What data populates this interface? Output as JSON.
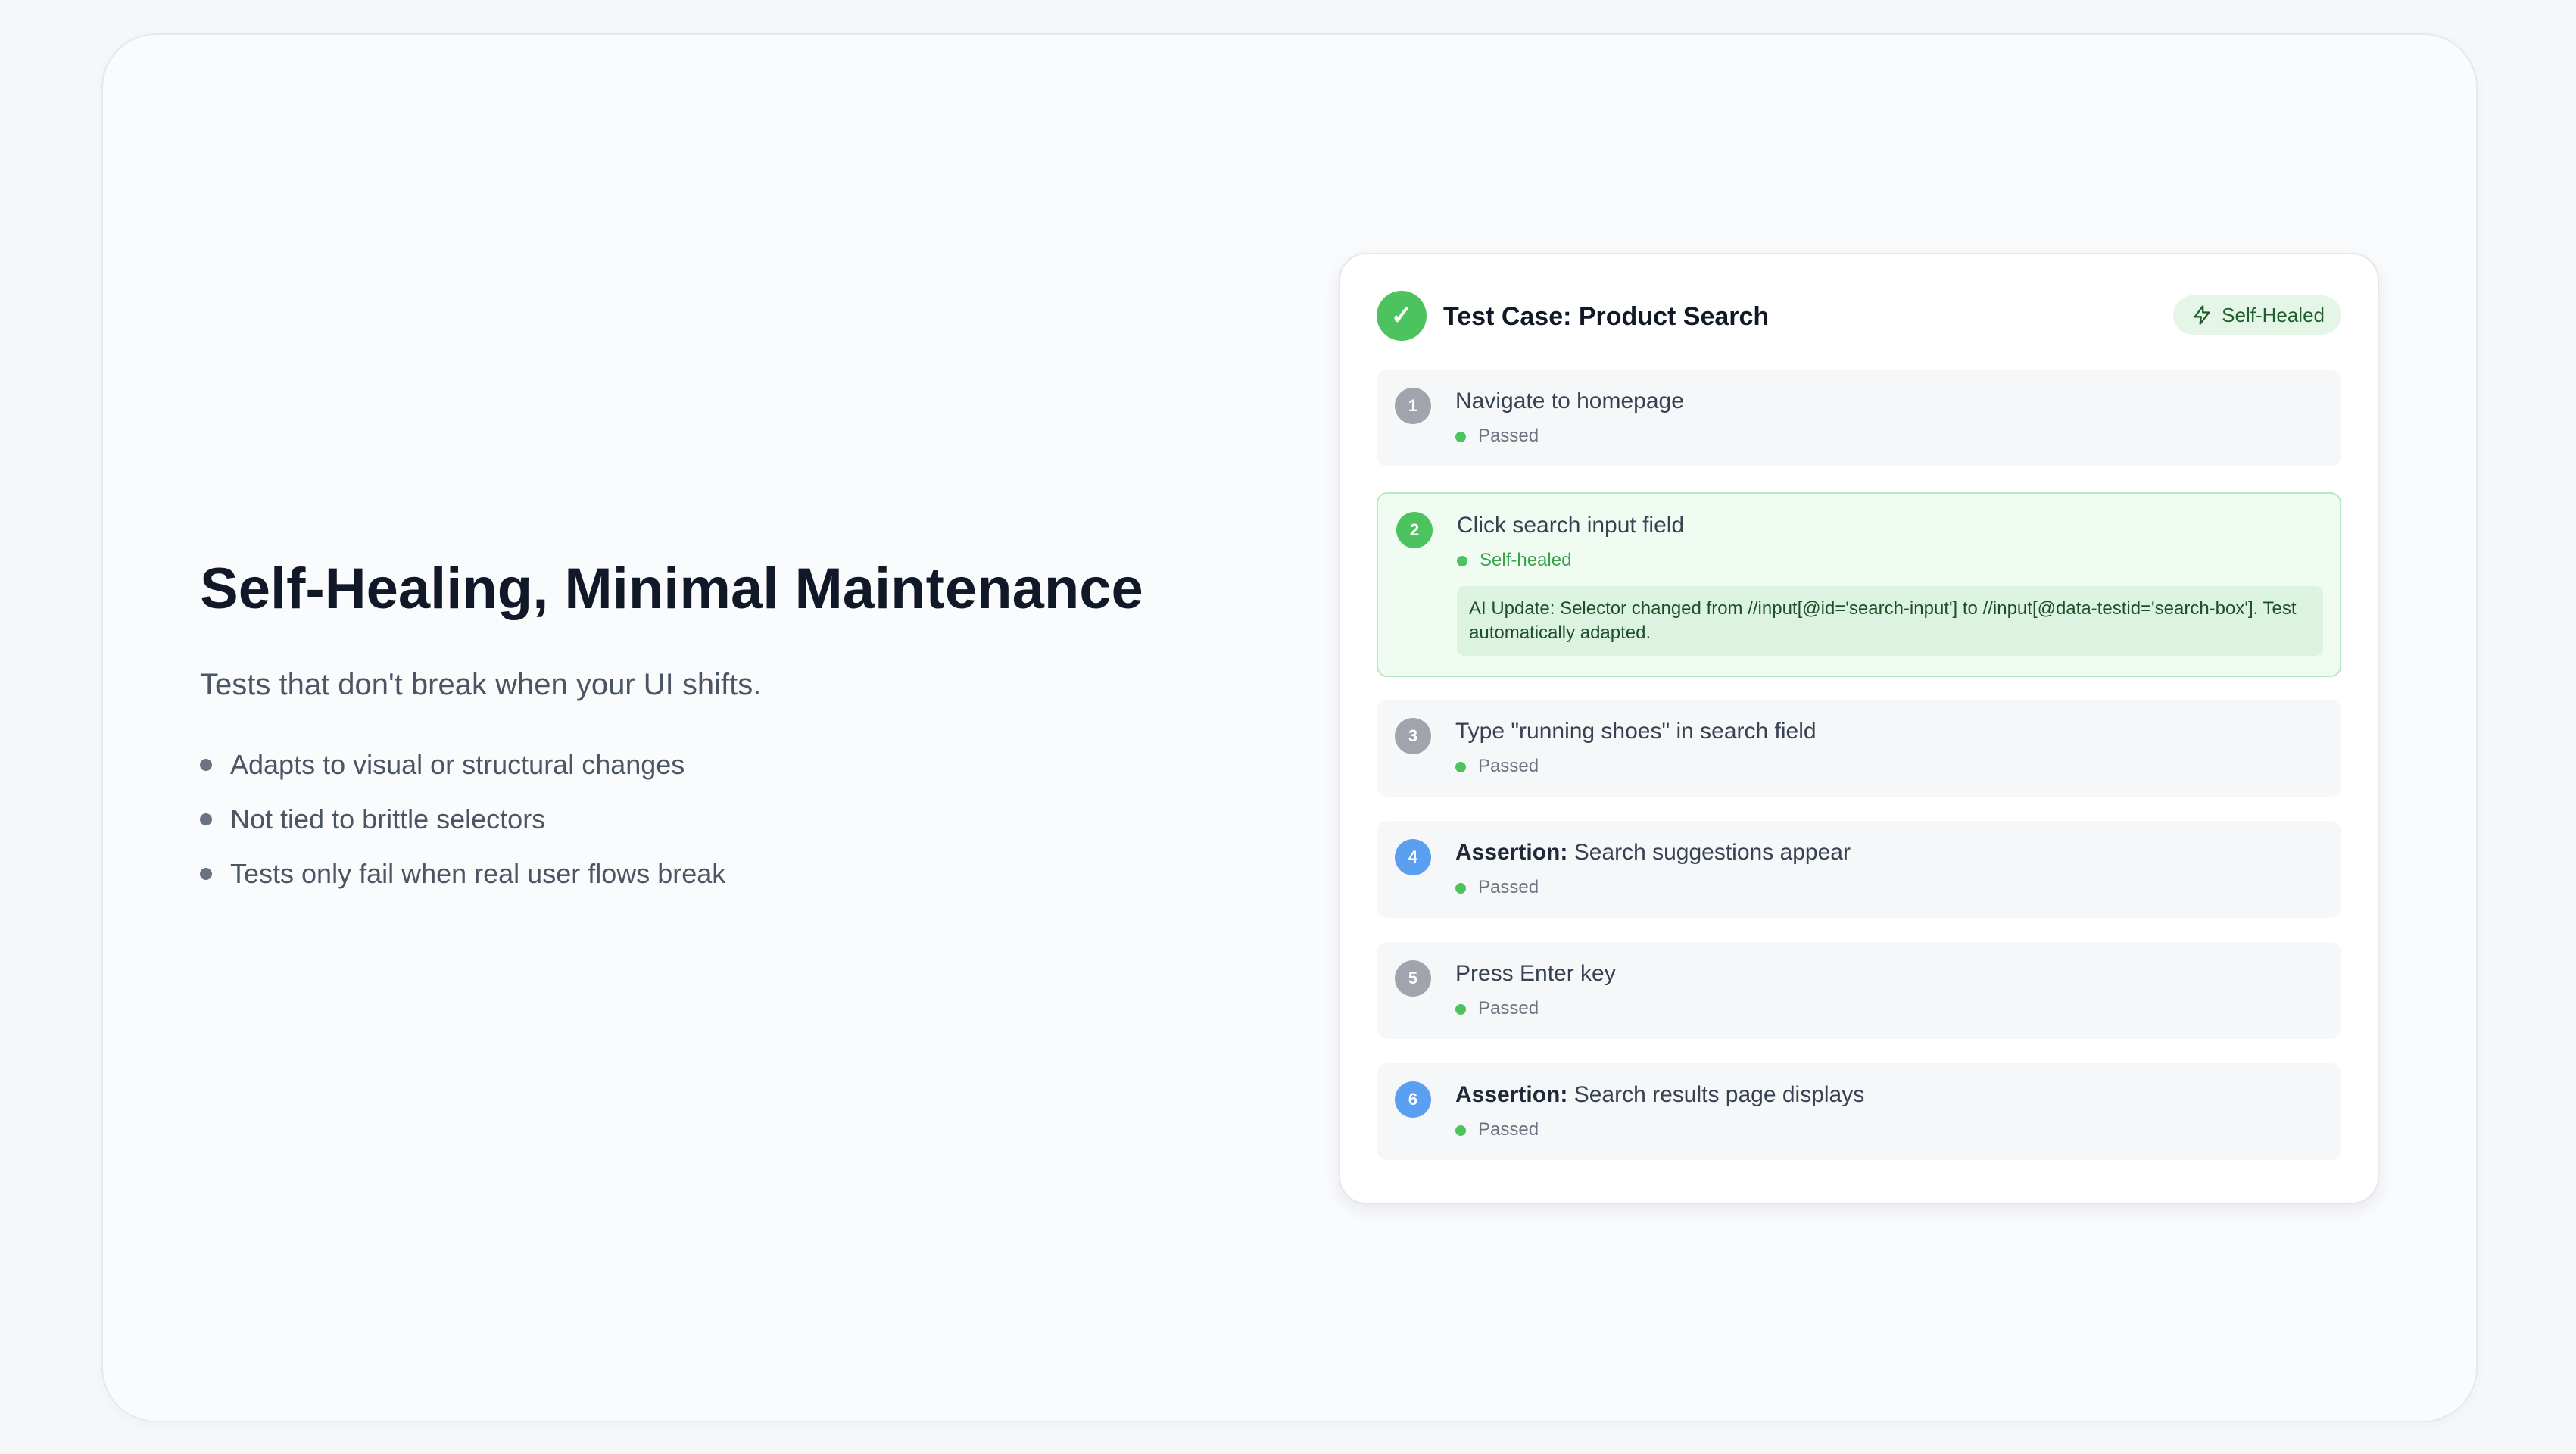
{
  "hero": {
    "headline": "Self-Healing, Minimal Maintenance",
    "subtitle": "Tests that don't break when your UI shifts.",
    "bullets": [
      "Adapts to visual or structural changes",
      "Not tied to brittle selectors",
      "Tests only fail when real user flows break"
    ]
  },
  "card": {
    "status_icon": "check-icon",
    "title": "Test Case: Product Search",
    "badge": {
      "icon": "lightning-icon",
      "label": "Self-Healed"
    },
    "steps": [
      {
        "number": "1",
        "prefix": "",
        "label": "Navigate to homepage",
        "status": "Passed",
        "number_color": "#a0a4ad"
      },
      {
        "number": "2",
        "prefix": "",
        "label": "Click search input field",
        "status": "Self-healed",
        "number_color": "#4cc35f",
        "note": "AI Update: Selector changed from //input[@id='search-input'] to //input[@data-testid='search-box']. Test automatically adapted."
      },
      {
        "number": "3",
        "prefix": "",
        "label": "Type \"running shoes\" in search field",
        "status": "Passed",
        "number_color": "#a0a4ad"
      },
      {
        "number": "4",
        "prefix": "Assertion:",
        "label": " Search suggestions appear",
        "status": "Passed",
        "number_color": "#5b9ff0"
      },
      {
        "number": "5",
        "prefix": "",
        "label": "Press Enter key",
        "status": "Passed",
        "number_color": "#a0a4ad"
      },
      {
        "number": "6",
        "prefix": "Assertion:",
        "label": " Search results page displays",
        "status": "Passed",
        "number_color": "#5b9ff0"
      }
    ]
  },
  "colors": {
    "success": "#4cc35f",
    "assertion": "#5b9ff0",
    "neutral_step": "#a0a4ad",
    "heading": "#111827"
  }
}
